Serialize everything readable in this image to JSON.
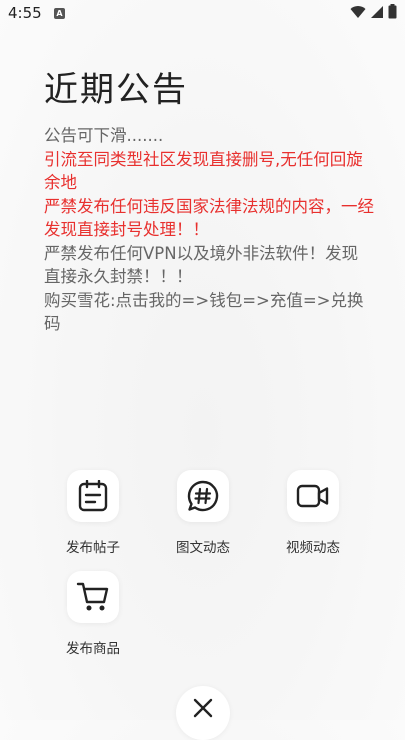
{
  "status_bar": {
    "time": "4:55",
    "app_icon": "A"
  },
  "page": {
    "title": "近期公告"
  },
  "notice": {
    "lines": [
      {
        "text": "公告可下滑.......",
        "color": "gray"
      },
      {
        "text": "引流至同类型社区发现直接删号,无任何回旋余地",
        "color": "red"
      },
      {
        "text": "严禁发布任何违反国家法律法规的内容，一经发现直接封号处理！！",
        "color": "red"
      },
      {
        "text": "严禁发布任何VPN以及境外非法软件！发现直接永久封禁！！！",
        "color": "gray"
      },
      {
        "text": "购买雪花:点击我的=>钱包=>充值=>兑换码",
        "color": "gray"
      }
    ]
  },
  "actions": {
    "post_topic": {
      "label": "发布帖子",
      "icon": "clipboard-icon"
    },
    "image_text": {
      "label": "图文动态",
      "icon": "hash-chat-icon"
    },
    "video": {
      "label": "视频动态",
      "icon": "video-camera-icon"
    },
    "product": {
      "label": "发布商品",
      "icon": "cart-icon"
    }
  },
  "close": {
    "icon": "close-icon"
  },
  "colors": {
    "red_text": "#e8302e",
    "gray_text": "#666666",
    "icon_stroke": "#222222"
  }
}
